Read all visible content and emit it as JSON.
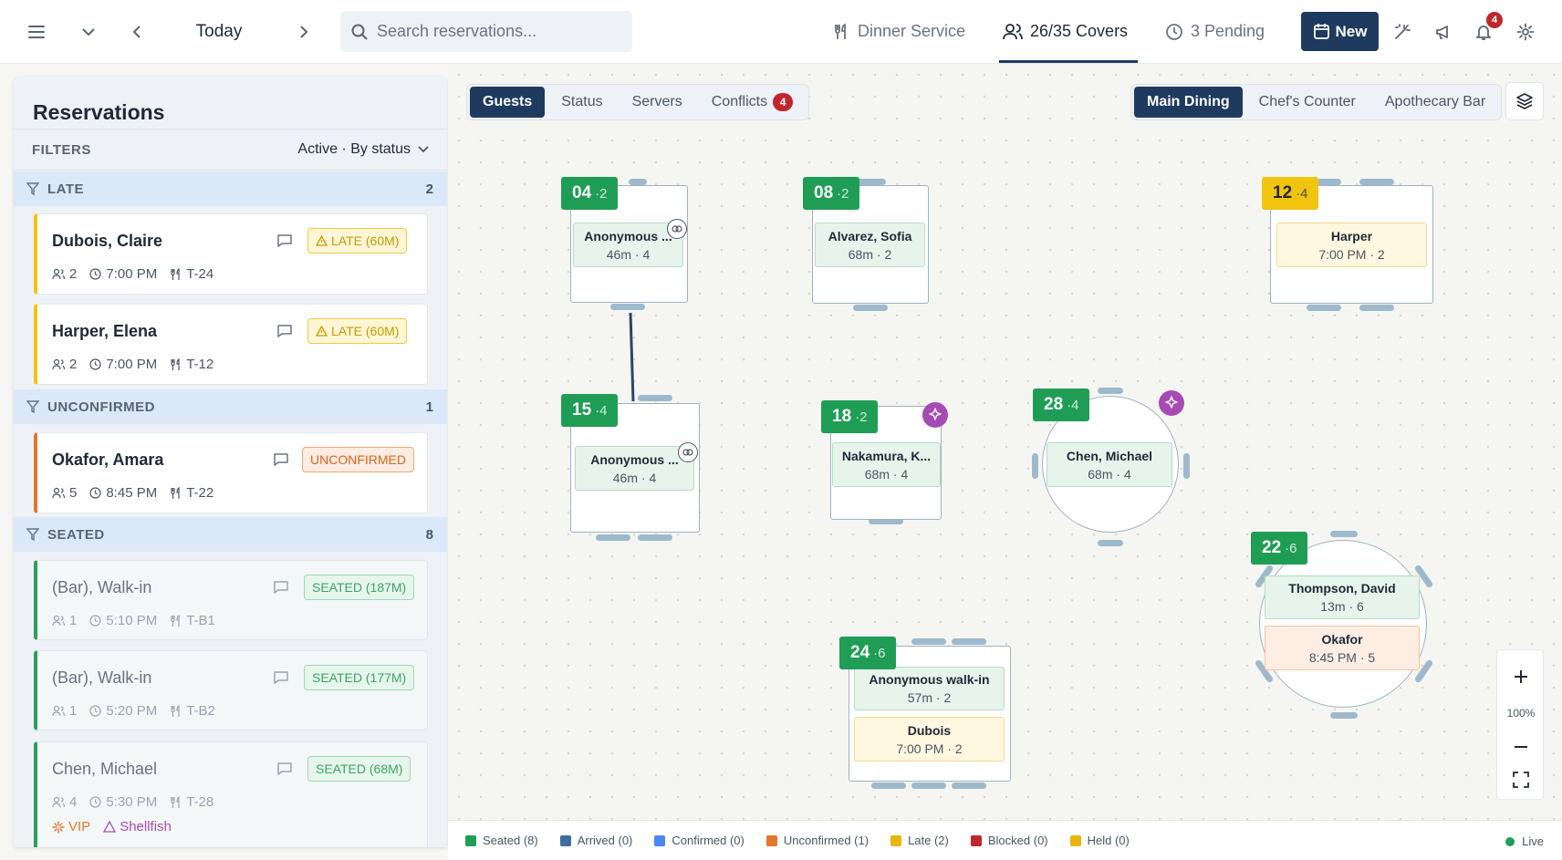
{
  "topbar": {
    "date_label": "Today",
    "search_placeholder": "Search reservations...",
    "service_label": "Dinner Service",
    "covers_label": "26/35 Covers",
    "pending_label": "3 Pending",
    "new_label": "New",
    "notif_count": "4"
  },
  "sidebar": {
    "title": "Reservations",
    "filters_label": "FILTERS",
    "filters_value": "Active · By status",
    "groups": [
      {
        "label": "LATE",
        "count": "2"
      },
      {
        "label": "UNCONFIRMED",
        "count": "1"
      },
      {
        "label": "SEATED",
        "count": "8"
      }
    ],
    "cards": [
      {
        "name": "Dubois, Claire",
        "party": "2",
        "time": "7:00 PM",
        "table": "T-24",
        "badge": "LATE (60M)"
      },
      {
        "name": "Harper, Elena",
        "party": "2",
        "time": "7:00 PM",
        "table": "T-12",
        "badge": "LATE (60M)"
      },
      {
        "name": "Okafor, Amara",
        "party": "5",
        "time": "8:45 PM",
        "table": "T-22",
        "badge": "UNCONFIRMED"
      },
      {
        "name": "(Bar), Walk-in",
        "party": "1",
        "time": "5:10 PM",
        "table": "T-B1",
        "badge": "SEATED (187M)"
      },
      {
        "name": "(Bar), Walk-in",
        "party": "1",
        "time": "5:20 PM",
        "table": "T-B2",
        "badge": "SEATED (177M)"
      },
      {
        "name": "Chen, Michael",
        "party": "4",
        "time": "5:30 PM",
        "table": "T-28",
        "badge": "SEATED (68M)",
        "tag_vip": "VIP",
        "tag_allergy": "Shellfish"
      }
    ]
  },
  "viewtabs": [
    {
      "label": "Guests"
    },
    {
      "label": "Status"
    },
    {
      "label": "Servers"
    },
    {
      "label": "Conflicts",
      "count": "4"
    }
  ],
  "rooms": [
    {
      "label": "Main Dining"
    },
    {
      "label": "Chef's Counter"
    },
    {
      "label": "Apothecary Bar"
    }
  ],
  "tables": {
    "t04": {
      "num": "04",
      "cap": "·2",
      "guest": "Anonymous ...",
      "sub": "46m · 4"
    },
    "t08": {
      "num": "08",
      "cap": "·2",
      "guest": "Alvarez, Sofia",
      "sub": "68m · 2"
    },
    "t12": {
      "num": "12",
      "cap": "·4",
      "guest": "Harper",
      "sub": "7:00 PM · 2"
    },
    "t15": {
      "num": "15",
      "cap": "·4",
      "guest": "Anonymous ...",
      "sub": "46m · 4"
    },
    "t18": {
      "num": "18",
      "cap": "·2",
      "guest": "Nakamura, K...",
      "sub": "68m · 4"
    },
    "t28": {
      "num": "28",
      "cap": "·4",
      "guest": "Chen, Michael",
      "sub": "68m · 4"
    },
    "t22": {
      "num": "22",
      "cap": "·6",
      "guest1": "Thompson, David",
      "sub1": "13m · 6",
      "guest2": "Okafor",
      "sub2": "8:45 PM · 5"
    },
    "t24": {
      "num": "24",
      "cap": "·6",
      "guest1": "Anonymous walk-in",
      "sub1": "57m · 2",
      "guest2": "Dubois",
      "sub2": "7:00 PM · 2"
    }
  },
  "zoom": {
    "level": "100%"
  },
  "legend": [
    {
      "label": "Seated (8)",
      "color": "#1f9d55"
    },
    {
      "label": "Arrived (0)",
      "color": "#3f6c9c"
    },
    {
      "label": "Confirmed (0)",
      "color": "#4c86f0"
    },
    {
      "label": "Unconfirmed (1)",
      "color": "#e4762b"
    },
    {
      "label": "Late (2)",
      "color": "#e9b50c"
    },
    {
      "label": "Blocked (0)",
      "color": "#c0262d"
    },
    {
      "label": "Held (0)",
      "color": "#e9b50c"
    }
  ],
  "live_label": "Live"
}
